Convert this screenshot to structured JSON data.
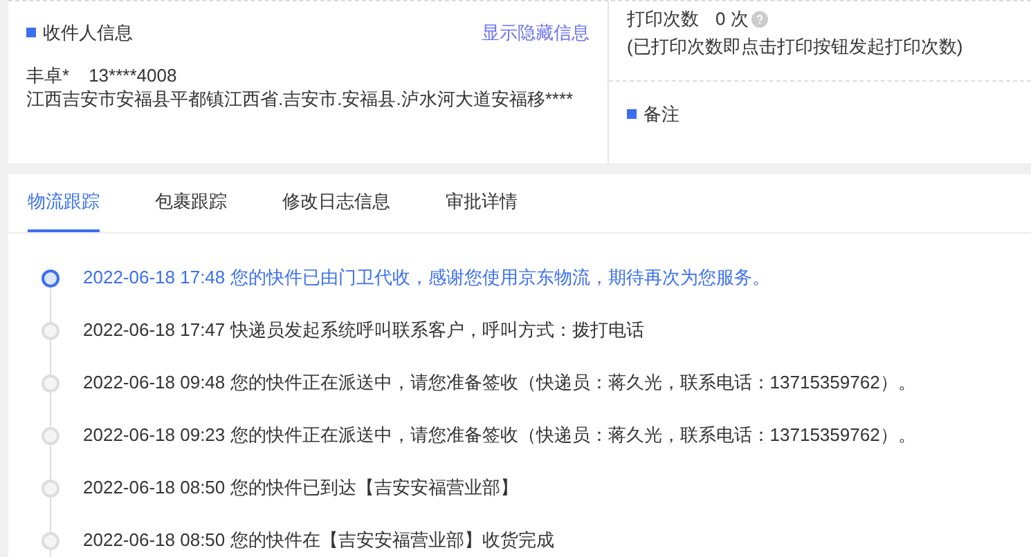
{
  "recipient": {
    "title": "收件人信息",
    "toggle_link": "显示隐藏信息",
    "name": "丰卓*",
    "phone": "13****4008",
    "address": "江西吉安市安福县平都镇江西省.吉安市.安福县.泸水河大道安福移****"
  },
  "print": {
    "label": "打印次数",
    "count": "0 次",
    "note": "(已打印次数即点击打印按钮发起打印次数)"
  },
  "remarks": {
    "title": "备注"
  },
  "tabs": [
    {
      "label": "物流跟踪",
      "selected": true
    },
    {
      "label": "包裹跟踪",
      "selected": false
    },
    {
      "label": "修改日志信息",
      "selected": false
    },
    {
      "label": "审批详情",
      "selected": false
    }
  ],
  "timeline": [
    {
      "time": "2022-06-18 17:48",
      "text": "您的快件已由门卫代收，感谢您使用京东物流，期待再次为您服务。",
      "current": true
    },
    {
      "time": "2022-06-18 17:47",
      "text": "快递员发起系统呼叫联系客户，呼叫方式：拨打电话",
      "current": false
    },
    {
      "time": "2022-06-18 09:48",
      "text": "您的快件正在派送中，请您准备签收（快递员：蒋久光，联系电话：13715359762）。",
      "current": false
    },
    {
      "time": "2022-06-18 09:23",
      "text": "您的快件正在派送中，请您准备签收（快递员：蒋久光，联系电话：13715359762）。",
      "current": false
    },
    {
      "time": "2022-06-18 08:50",
      "text": "您的快件已到达【吉安安福营业部】",
      "current": false
    },
    {
      "time": "2022-06-18 08:50",
      "text": "您的快件在【吉安安福营业部】收货完成",
      "current": false
    }
  ]
}
